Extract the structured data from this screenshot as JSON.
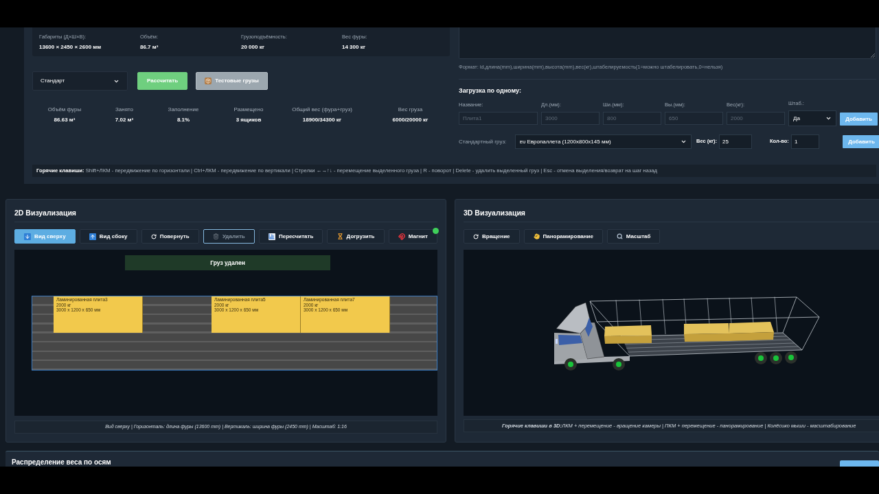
{
  "truck_specs": [
    {
      "label": "Габариты (Д×Ш×В):",
      "value": "13600 × 2450 × 2600 мм"
    },
    {
      "label": "Объём:",
      "value": "86.7 м³"
    },
    {
      "label": "Грузоподъёмность:",
      "value": "20 000 кг"
    },
    {
      "label": "Вес фуры:",
      "value": "14 300 кг"
    }
  ],
  "bulk_input": {
    "format_hint": "Формат: id,длина(mm),ширина(mm),высота(mm),вес(кг),штабелируемость(1=можно штабелировать,0=нельзя)"
  },
  "truck_type_select": {
    "value": "Стандарт"
  },
  "actions": [
    {
      "label": "Рассчитать",
      "kind": "primary"
    },
    {
      "label": "Тестовые грузы",
      "kind": "secondary"
    }
  ],
  "stats": [
    {
      "label": "Объём фуры",
      "value": "86.63 м³"
    },
    {
      "label": "Занято",
      "value": "7.02 м³"
    },
    {
      "label": "Заполнение",
      "value": "8.1%"
    },
    {
      "label": "Размещено",
      "value": "3 ящиков"
    },
    {
      "label": "Общий вес (фура+груз)",
      "value": "18900/34300 кг"
    },
    {
      "label": "Вес груза",
      "value": "6000/20000 кг"
    }
  ],
  "single_load": {
    "title": "Загрузка по одному:",
    "fields": [
      {
        "label": "Название:",
        "placeholder": "Плита1"
      },
      {
        "label": "Дл.(мм):",
        "placeholder": "3000"
      },
      {
        "label": "Ши.(мм):",
        "placeholder": "800"
      },
      {
        "label": "Вы.(мм):",
        "placeholder": "650"
      },
      {
        "label": "Вес(кг):",
        "placeholder": "2000"
      }
    ],
    "stack_label": "Штаб.:",
    "stack_value": "Да",
    "add_button": "Добавить"
  },
  "standard_load": {
    "label": "Стандартный груз:",
    "value": "ᴇᴜ Европаллета (1200x800x145 мм)",
    "weight_label": "Вес (кг):",
    "weight_value": "25",
    "qty_label": "Кол-во:",
    "qty_value": "1",
    "add_button": "Добавить"
  },
  "hotkeys": "**Горячие клавиши:** Shift+ЛКМ - передвижение по горизонтали | Ctrl+ЛКМ - передвижение по вертикали | Стрелки ←→↑↓ - перемещение выделенного груза | R - поворот | Delete - удалить выделенный груз | Esc - отмена выделения/возврат на шаг назад",
  "view2d": {
    "title": "2D Визуализация",
    "toolbar": [
      {
        "label": "Вид сверху",
        "selected": true,
        "disabled": false,
        "focused": false
      },
      {
        "label": "Вид сбоку",
        "selected": false,
        "disabled": false,
        "focused": false
      },
      {
        "label": "Повернуть",
        "selected": false,
        "disabled": false,
        "focused": false
      },
      {
        "label": "Удалить",
        "selected": false,
        "disabled": true,
        "focused": true
      },
      {
        "label": "Пересчитать",
        "selected": false,
        "disabled": false,
        "focused": false
      },
      {
        "label": "Догрузить",
        "selected": false,
        "disabled": false,
        "focused": false
      },
      {
        "label": "Магнит",
        "selected": false,
        "disabled": false,
        "focused": false
      }
    ],
    "magnet_indicator": {
      "on": true
    },
    "toast": "Груз удален",
    "cargo": [
      {
        "name": "Ламинированная плита3",
        "weight": "2000 кг",
        "size": "3000 x 1200 x 650 мм"
      },
      {
        "name": "Ламинированная плита5",
        "weight": "2000 кг",
        "size": "3000 x 1200 x 650 мм"
      },
      {
        "name": "Ламинированная плита7",
        "weight": "2000 кг",
        "size": "3000 x 1200 x 650 мм"
      }
    ],
    "caption": "Вид сверху | Горизонталь: длина фуры (13600 mm) | Вертикаль: ширина фуры (2450 mm) | Масштаб: 1:16"
  },
  "view3d": {
    "title": "3D Визуализация",
    "toolbar": [
      {
        "label": "Вращение"
      },
      {
        "label": "Панорамирование"
      },
      {
        "label": "Масштаб"
      }
    ],
    "caption": "**Горячие клавиши в 3D:**ЛКМ + перемещение - вращение камеры | ПКМ + перемещение - панорамирование | Колёсико мыши - масштабирование"
  },
  "axle_weight": {
    "title": "Распределение веса по осям"
  }
}
